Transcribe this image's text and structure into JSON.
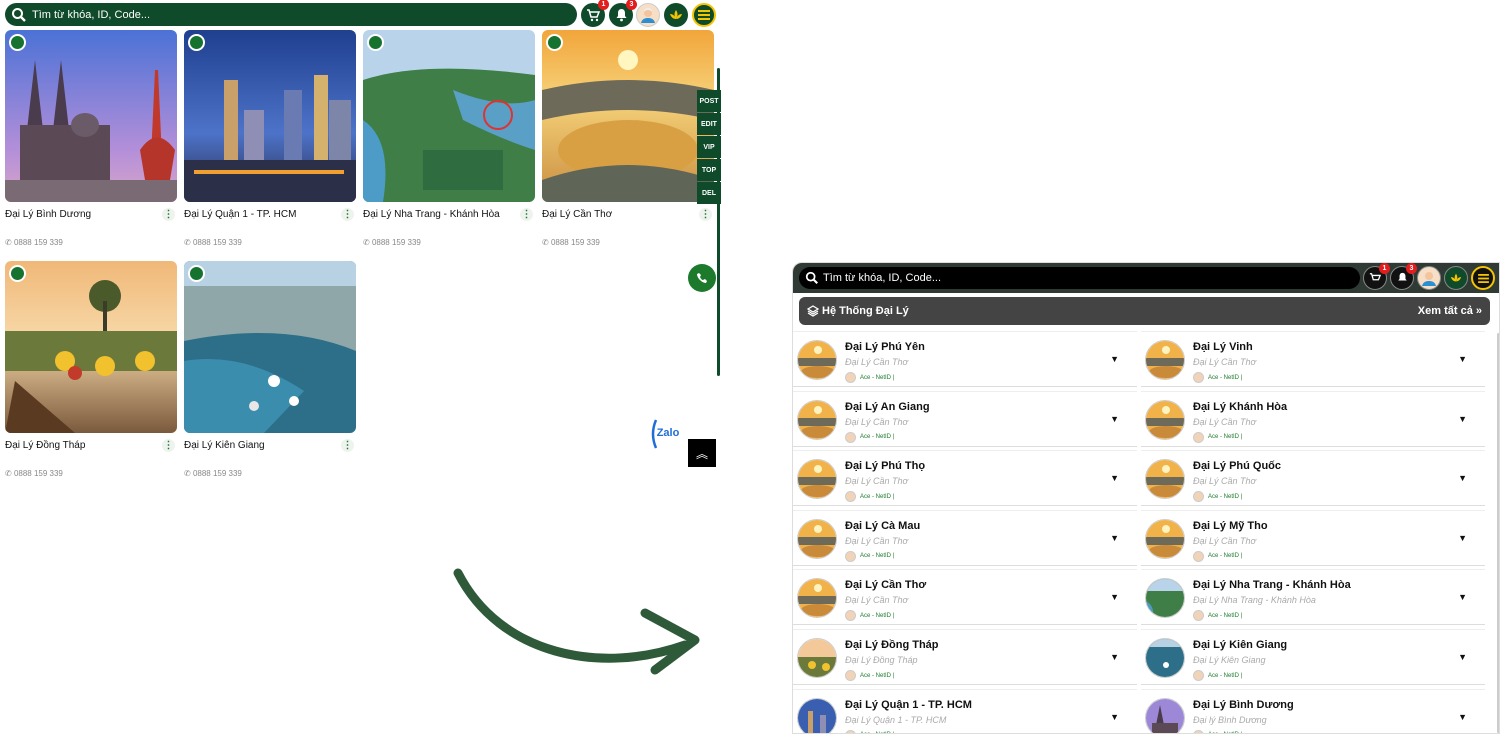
{
  "left": {
    "search_placeholder": "Tìm từ khóa, ID, Code...",
    "cart_badge": "1",
    "bell_badge": "3",
    "cards": [
      {
        "name": "Đại Lý Bình Dương",
        "phone": "0888 159 339"
      },
      {
        "name": "Đại Lý Quận 1 - TP. HCM",
        "phone": "0888 159 339"
      },
      {
        "name": "Đại Lý Nha Trang - Khánh Hòa",
        "phone": "0888 159 339"
      },
      {
        "name": "Đại Lý Cần Thơ",
        "phone": "0888 159 339"
      },
      {
        "name": "Đại Lý Đồng Tháp",
        "phone": "0888 159 339"
      },
      {
        "name": "Đại Lý Kiên Giang",
        "phone": "0888 159 339"
      }
    ],
    "side_tools": [
      "POST",
      "EDIT",
      "VIP",
      "TOP",
      "DEL"
    ],
    "zalo_label": "Zalo"
  },
  "right": {
    "search_placeholder": "Tìm từ khóa, ID, Code...",
    "cart_badge": "1",
    "bell_badge": "3",
    "section_title": "Hệ Thống Đại Lý",
    "view_all": "Xem tất cả",
    "items_left": [
      {
        "title": "Đại Lý Phú Yên",
        "sub": "Đại Lý Cần Thơ",
        "acc": "Ace - NetID |"
      },
      {
        "title": "Đại Lý An Giang",
        "sub": "Đại Lý Cần Thơ",
        "acc": "Ace - NetID |"
      },
      {
        "title": "Đại Lý Phú Thọ",
        "sub": "Đại Lý Cần Thơ",
        "acc": "Ace - NetID |"
      },
      {
        "title": "Đại Lý Cà Mau",
        "sub": "Đại Lý Cần Thơ",
        "acc": "Ace - NetID |"
      },
      {
        "title": "Đại Lý Cần Thơ",
        "sub": "Đại Lý Cần Thơ",
        "acc": "Ace - NetID |"
      },
      {
        "title": "Đại Lý Đồng Tháp",
        "sub": "Đại Lý Đồng Tháp",
        "acc": "Ace - NetID |"
      },
      {
        "title": "Đại Lý Quận 1 - TP. HCM",
        "sub": "Đại Lý Quận 1 - TP. HCM",
        "acc": "Ace - NetID |"
      }
    ],
    "items_right": [
      {
        "title": "Đại Lý Vinh",
        "sub": "Đại Lý Cần Thơ",
        "acc": "Ace - NetID |"
      },
      {
        "title": "Đại Lý Khánh Hòa",
        "sub": "Đại Lý Cần Thơ",
        "acc": "Ace - NetID |"
      },
      {
        "title": "Đại Lý Phú Quốc",
        "sub": "Đại Lý Cần Thơ",
        "acc": "Ace - NetID |"
      },
      {
        "title": "Đại Lý Mỹ Tho",
        "sub": "Đại Lý Cần Thơ",
        "acc": "Ace - NetID |"
      },
      {
        "title": "Đại Lý Nha Trang - Khánh Hòa",
        "sub": "Đại Lý Nha Trang - Khánh Hòa",
        "acc": "Ace - NetID |"
      },
      {
        "title": "Đại Lý Kiên Giang",
        "sub": "Đại Lý Kiên Giang",
        "acc": "Ace - NetID |"
      },
      {
        "title": "Đại Lý Bình Dương",
        "sub": "Đại lý Bình Dương",
        "acc": "Ace - NetID |"
      }
    ]
  }
}
